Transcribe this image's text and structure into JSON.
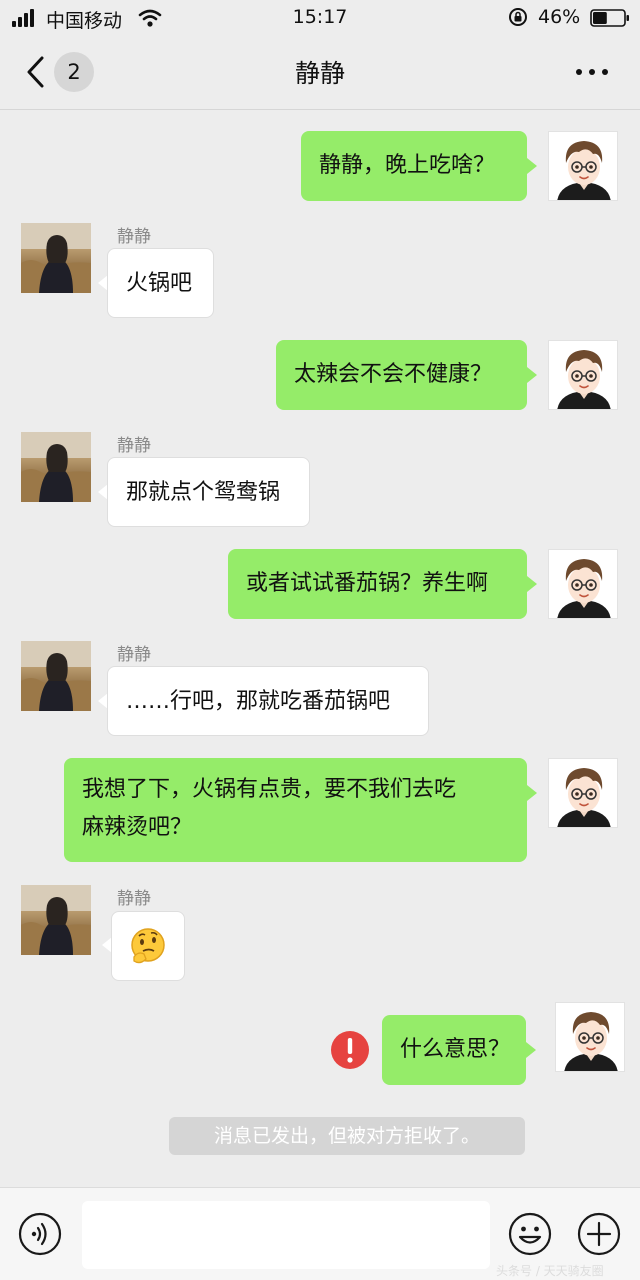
{
  "status_bar": {
    "carrier": "中国移动",
    "time": "15:17",
    "battery_percent": "46%",
    "battery_level": 0.46,
    "icons": [
      "signal-icon",
      "wifi-icon",
      "orientation-lock-icon",
      "battery-icon"
    ]
  },
  "nav": {
    "back_icon": "chevron-left-icon",
    "unread_count": "2",
    "title": "静静",
    "more_icon": "ellipsis-icon"
  },
  "messages": [
    {
      "from": "me",
      "text": "静静，晚上吃啥？"
    },
    {
      "from": "her",
      "sender": "静静",
      "text": "火锅吧"
    },
    {
      "from": "me",
      "text": "太辣会不会不健康？"
    },
    {
      "from": "her",
      "sender": "静静",
      "text": "那就点个鸳鸯锅"
    },
    {
      "from": "me",
      "text": "或者试试番茄锅？养生啊"
    },
    {
      "from": "her",
      "sender": "静静",
      "text": "……行吧，那就吃番茄锅吧"
    },
    {
      "from": "me",
      "lines": [
        "我想了下，火锅有点贵，要不我们去吃",
        "麻辣烫吧？"
      ]
    },
    {
      "from": "her",
      "sender": "静静",
      "emoji": "thinking-emoji-icon"
    },
    {
      "from": "me",
      "text": "什么意思？",
      "status": "send-failed-icon"
    }
  ],
  "system_notice": "消息已发出，但被对方拒收了。",
  "input_bar": {
    "voice_icon": "voice-icon",
    "emoji_icon": "emoji-icon",
    "add_icon": "add-icon",
    "draft": ""
  },
  "watermark": "头条号 / 天天骑友圈",
  "colors": {
    "my_bubble": "#95ec69",
    "her_bubble": "#ffffff",
    "background": "#ededed",
    "error_red": "#e64340"
  }
}
